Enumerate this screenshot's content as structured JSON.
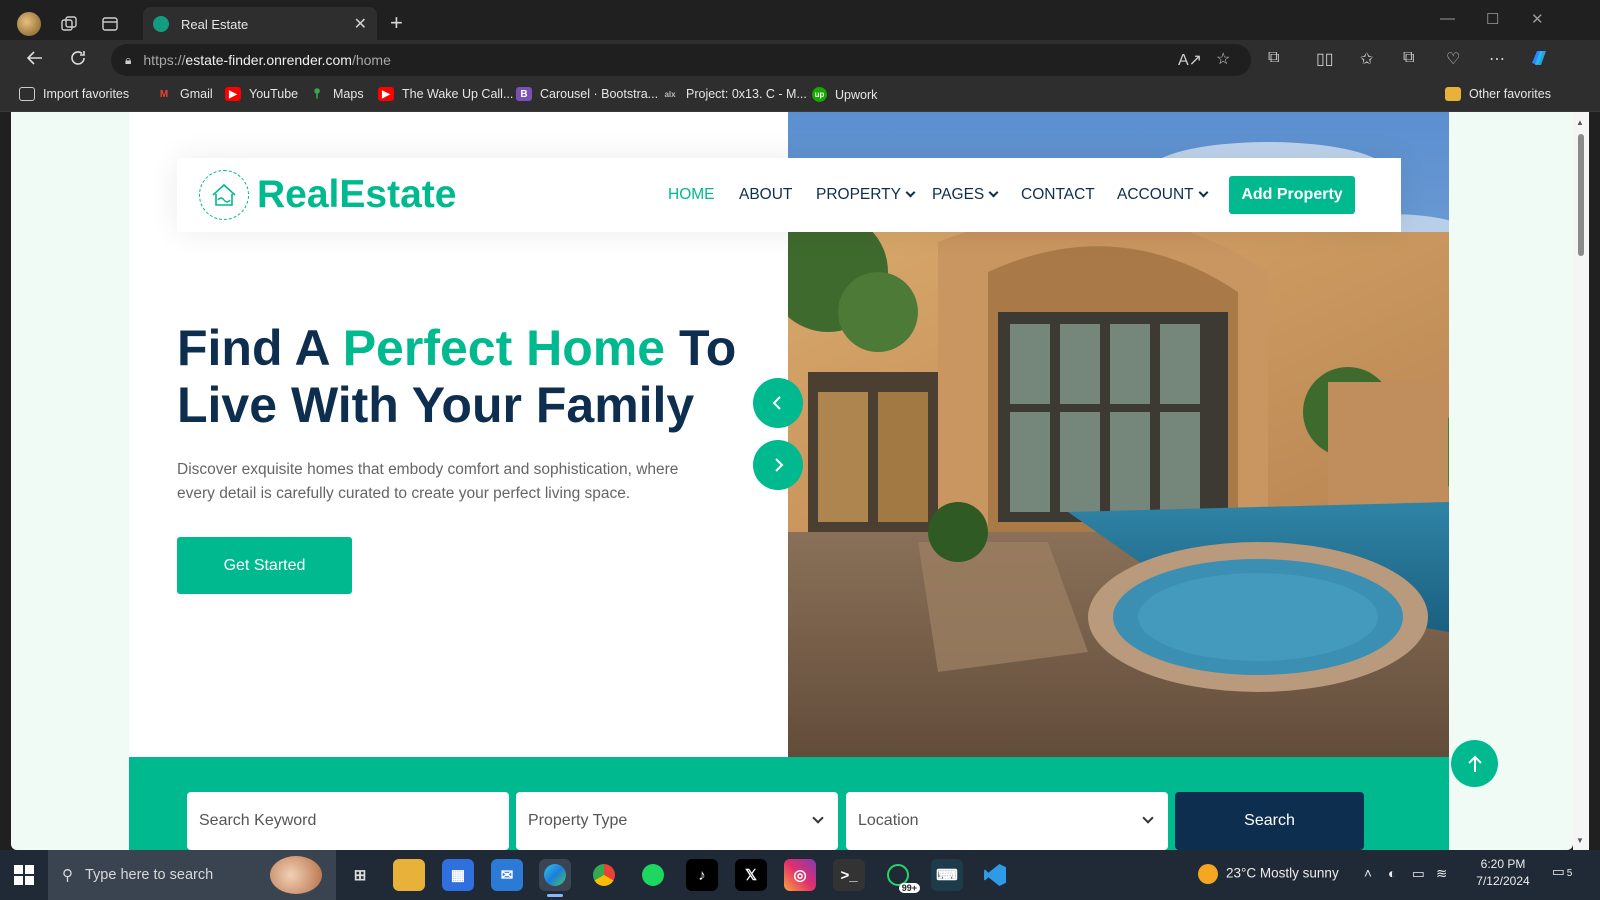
{
  "browser": {
    "tab_title": "Real Estate",
    "url_scheme": "https://",
    "url_host": "estate-finder.onrender.com",
    "url_path": "/home"
  },
  "bookmarks": [
    {
      "label": "Import favorites",
      "icon": "import-icon",
      "color": "#3a3a3a"
    },
    {
      "label": "Gmail",
      "icon": "gmail-icon",
      "color": "#ea4335"
    },
    {
      "label": "YouTube",
      "icon": "youtube-icon",
      "color": "#ff0000"
    },
    {
      "label": "Maps",
      "icon": "maps-icon",
      "color": "#34a853"
    },
    {
      "label": "The Wake Up Call...",
      "icon": "youtube-icon",
      "color": "#ff0000"
    },
    {
      "label": "Carousel · Bootstra...",
      "icon": "bootstrap-icon",
      "color": "#7952b3"
    },
    {
      "label": "Project: 0x13. C - M...",
      "icon": "alx-icon",
      "color": "#3a3a3a"
    },
    {
      "label": "Upwork",
      "icon": "upwork-icon",
      "color": "#14a800"
    }
  ],
  "other_favorites": "Other favorites",
  "site": {
    "brand": "RealEstate",
    "nav": [
      {
        "label": "HOME",
        "active": true
      },
      {
        "label": "ABOUT",
        "active": false
      },
      {
        "label": "PROPERTY",
        "active": false,
        "dropdown": true
      },
      {
        "label": "PAGES",
        "active": false,
        "dropdown": true
      },
      {
        "label": "CONTACT",
        "active": false
      },
      {
        "label": "ACCOUNT",
        "active": false,
        "dropdown": true
      }
    ],
    "add_property": "Add Property",
    "headline_1": "Find A ",
    "headline_accent": "Perfect Home",
    "headline_2": " To Live With Your Family",
    "lead": "Discover exquisite homes that embody comfort and sophistication, where every detail is carefully curated to create your perfect living space.",
    "cta": "Get Started",
    "search": {
      "keyword_placeholder": "Search Keyword",
      "type_placeholder": "Property Type",
      "location_placeholder": "Location",
      "button": "Search"
    },
    "colors": {
      "primary": "#00b98e",
      "dark": "#0e2e50",
      "light_bg": "#f0fbf6"
    }
  },
  "taskbar": {
    "search_placeholder": "Type here to search",
    "weather": "23°C  Mostly sunny",
    "time": "6:20 PM",
    "date": "7/12/2024",
    "whatsapp_badge": "99+",
    "notification_count": "5"
  }
}
